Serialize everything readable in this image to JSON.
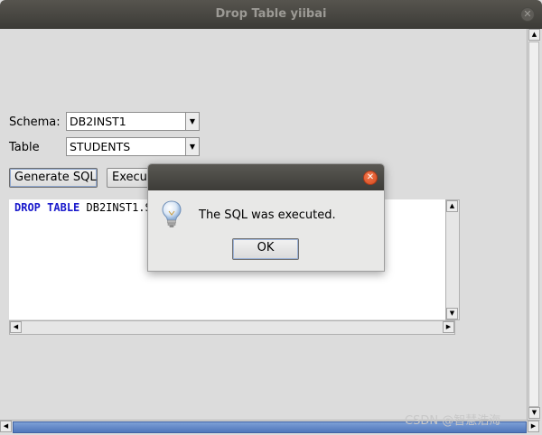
{
  "window": {
    "title": "Drop Table yiibai",
    "close_glyph": "✕"
  },
  "form": {
    "schema_label": "Schema:",
    "schema_value": "DB2INST1",
    "table_label": "Table",
    "table_value": "STUDENTS",
    "dropdown_glyph": "▼"
  },
  "toolbar": {
    "generate_label": "Generate SQL",
    "execute_label": "Execute"
  },
  "editor": {
    "kw_drop": "DROP",
    "kw_table": "TABLE",
    "sql_rest": " DB2INST1.S"
  },
  "scroll_glyphs": {
    "up": "▲",
    "down": "▼",
    "left": "◀",
    "right": "▶"
  },
  "dialog": {
    "close_glyph": "✕",
    "message": "The SQL was executed.",
    "ok_label": "OK",
    "icon": "lightbulb-icon"
  },
  "watermark": "CSDN @智慧浩海"
}
